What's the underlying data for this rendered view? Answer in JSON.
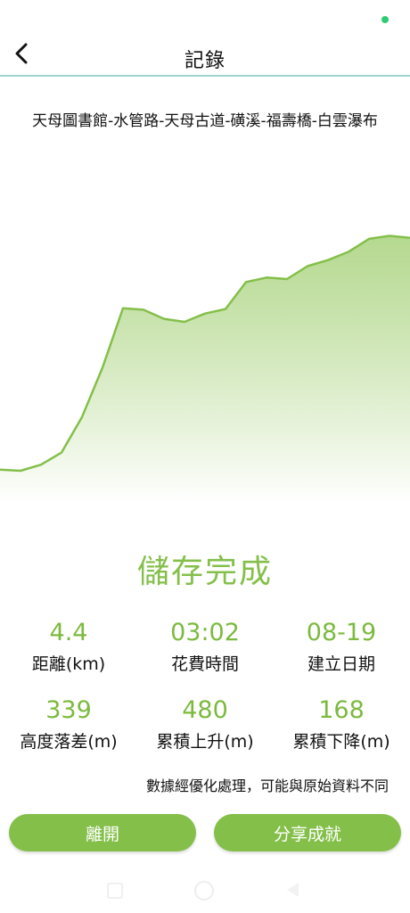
{
  "header": {
    "title": "記錄",
    "back_icon": "chevron-left-icon"
  },
  "route": {
    "name": "天母圖書館-水管路-天母古道-磺溪-福壽橋-白雲瀑布"
  },
  "colors": {
    "accent": "#84bf4a",
    "stat_value": "#7cba3e",
    "status_dot": "#2ecc71",
    "divider": "#9fd3cc"
  },
  "chart_data": {
    "type": "area",
    "x": [
      0,
      0.05,
      0.1,
      0.15,
      0.2,
      0.25,
      0.3,
      0.35,
      0.4,
      0.45,
      0.5,
      0.55,
      0.6,
      0.65,
      0.7,
      0.75,
      0.8,
      0.85,
      0.9,
      0.95,
      1.0
    ],
    "values": [
      490,
      487,
      503,
      535,
      629,
      759,
      916,
      912,
      888,
      880,
      902,
      914,
      985,
      997,
      993,
      1027,
      1043,
      1065,
      1099,
      1107,
      1102
    ],
    "ylim": [
      400,
      1200
    ],
    "grid": false,
    "legend": "none"
  },
  "main": {
    "save_message": "儲存完成",
    "stats": [
      {
        "value": "4.4",
        "label": "距離(km)"
      },
      {
        "value": "03:02",
        "label": "花費時間"
      },
      {
        "value": "08-19",
        "label": "建立日期"
      },
      {
        "value": "339",
        "label": "高度落差(m)"
      },
      {
        "value": "480",
        "label": "累積上升(m)"
      },
      {
        "value": "168",
        "label": "累積下降(m)"
      }
    ],
    "note": "數據經優化處理，可能與原始資料不同"
  },
  "buttons": {
    "leave": "離開",
    "share": "分享成就"
  }
}
